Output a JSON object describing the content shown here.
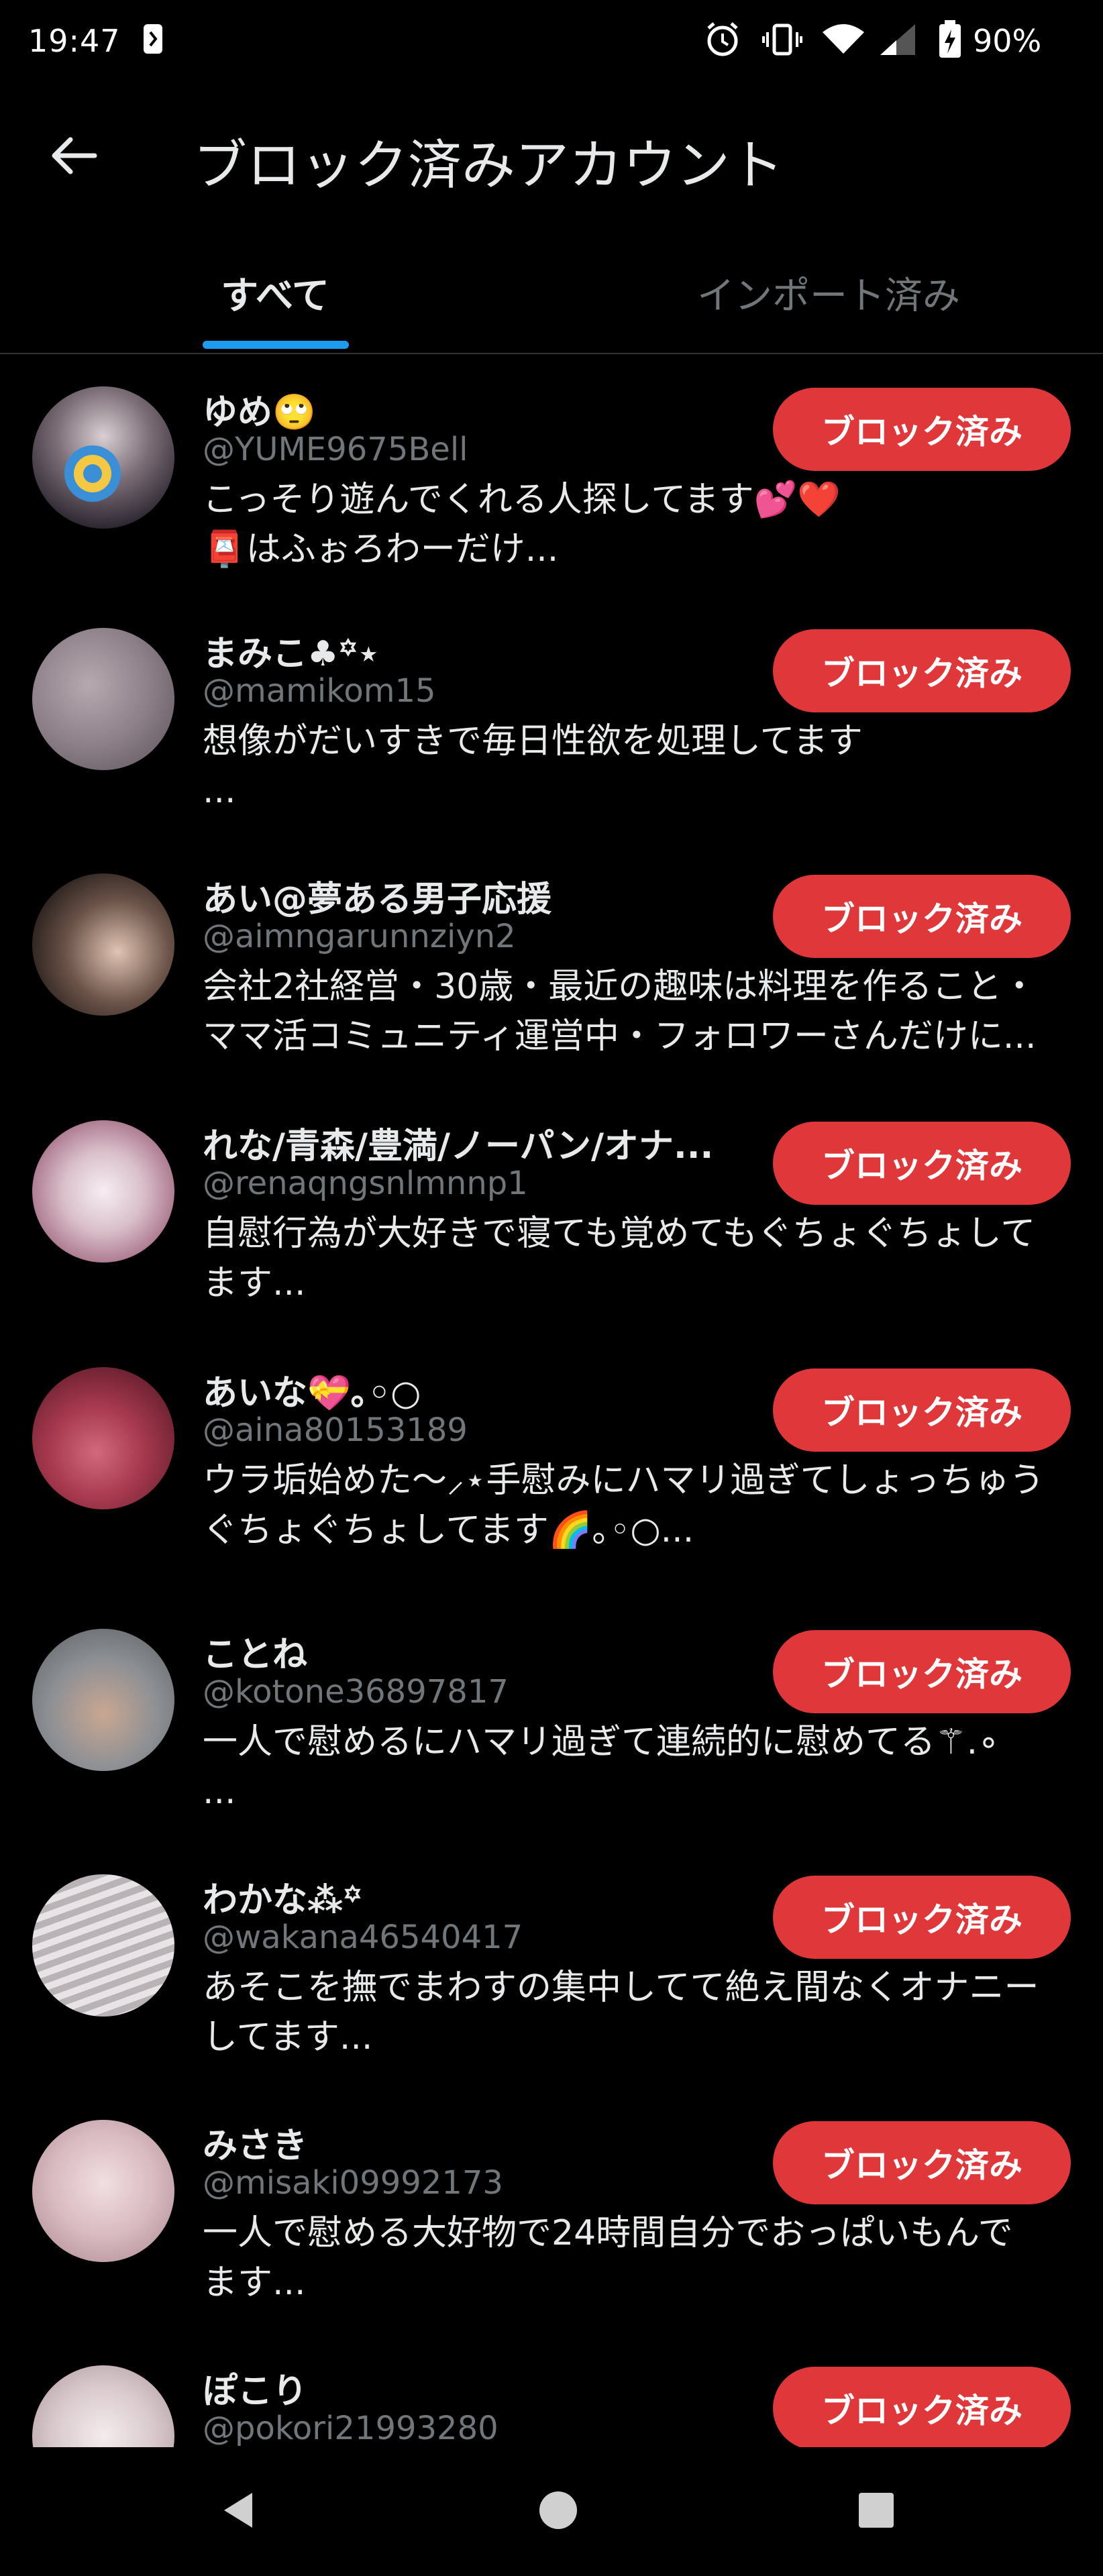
{
  "status_bar": {
    "time": "19:47",
    "battery": "90%",
    "icons": [
      "notification-icon",
      "alarm-icon",
      "vibrate-icon",
      "wifi-icon",
      "signal-icon",
      "battery-charging-icon"
    ]
  },
  "header": {
    "title": "ブロック済みアカウント",
    "back_icon": "back-arrow-icon"
  },
  "tabs": [
    {
      "label": "すべて",
      "active": true
    },
    {
      "label": "インポート済み",
      "active": false
    }
  ],
  "colors": {
    "accent": "#1d9bf0",
    "blocked_button": "#e0373b",
    "secondary_text": "#71767b",
    "primary_text": "#e7e9ea",
    "background": "#000000"
  },
  "button_label": "ブロック済み",
  "accounts": [
    {
      "name": "ゆめ🙄",
      "handle": "@YUME9675Bell",
      "bio": "こっそり遊んでくれる人探してます💕❤️\n📮はふぉろわーだけ..."
    },
    {
      "name": "まみこ♣︎꙳⋆",
      "handle": "@mamikom15",
      "bio": "想像がだいすきで毎日性欲を処理してます\n..."
    },
    {
      "name": "あい@夢ある男子応援",
      "handle": "@aimngarunnziyn2",
      "bio": "会社2社経営・30歳・最近の趣味は料理を作ること・\nママ活コミュニティ運営中・フォロワーさんだけに..."
    },
    {
      "name": "れな/青森/豊満/ノーパン/オナ...",
      "handle": "@renaqngsnlmnnp1",
      "bio": "自慰行為が大好きで寝ても覚めてもぐちょぐちょして\nます..."
    },
    {
      "name": "あいな💝｡◦○",
      "handle": "@aina80153189",
      "bio": "ウラ垢始めた〜⸝⋆手慰みにハマリ過ぎてしょっちゅう\nぐちょぐちょしてます🌈｡◦○..."
    },
    {
      "name": "ことね",
      "handle": "@kotone36897817",
      "bio": "一人で慰めるにハマリ過ぎて連続的に慰めてる⚚.∘\n..."
    },
    {
      "name": "わかな⁂꙳",
      "handle": "@wakana46540417",
      "bio": "あそこを撫でまわすの集中してて絶え間なくオナニー\nしてます..."
    },
    {
      "name": "みさき",
      "handle": "@misaki09992173",
      "bio": "一人で慰める大好物で24時間自分でおっぱいもんで\nます..."
    },
    {
      "name": "ぽこり",
      "handle": "@pokori21993280",
      "bio": ""
    }
  ],
  "nav": [
    "back-triangle-icon",
    "home-circle-icon",
    "recents-square-icon"
  ]
}
